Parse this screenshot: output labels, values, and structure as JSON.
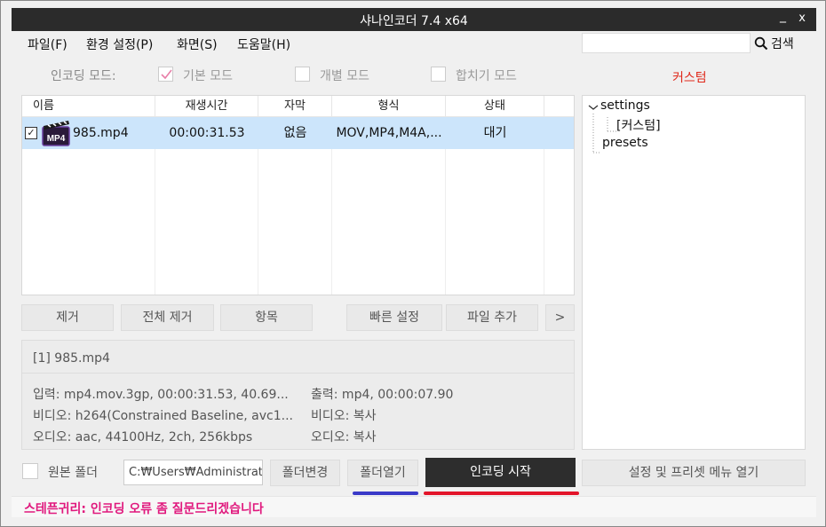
{
  "window": {
    "title": "샤나인코더  7.4 x64",
    "minimize": "_",
    "close": "x"
  },
  "menu": {
    "items": [
      "파일(F)",
      "환경 설정(P)",
      "화면(S)",
      "도움말(H)"
    ],
    "search_label": "검색",
    "search_value": ""
  },
  "mode": {
    "label": "인코딩 모드:",
    "options": [
      {
        "label": "기본 모드",
        "checked": true
      },
      {
        "label": "개별 모드",
        "checked": false
      },
      {
        "label": "합치기 모드",
        "checked": false
      }
    ],
    "custom": "커스텀"
  },
  "filelist": {
    "columns": [
      "이름",
      "재생시간",
      "자막",
      "형식",
      "상태"
    ],
    "rows": [
      {
        "checked": true,
        "icon_text": "MP4",
        "name": "985.mp4",
        "duration": "00:00:31.53",
        "subtitle": "없음",
        "format": "MOV,MP4,M4A,...",
        "status": "대기"
      }
    ]
  },
  "buttons": {
    "remove": "제거",
    "remove_all": "전체 제거",
    "item": "항목",
    "quick_settings": "빠른 설정",
    "add_file": "파일 추가",
    "more": ">"
  },
  "info": {
    "header": "[1] 985.mp4",
    "input": "입력: mp4.mov.3gp, 00:00:31.53, 40.69...",
    "video_in": "비디오: h264(Constrained Baseline, avc1...",
    "audio_in": "오디오: aac, 44100Hz, 2ch, 256kbps",
    "output": "출력: mp4, 00:00:07.90",
    "video_out": "비디오: 복사",
    "audio_out": "오디오: 복사"
  },
  "tree": {
    "root": "settings",
    "child": "[커스텀]",
    "presets": "presets"
  },
  "bottom": {
    "source_folder": "원본 폴더",
    "path": "C:₩Users₩Administrator",
    "change_folder": "폴더변경",
    "open_folder": "폴더열기",
    "start_encoding": "인코딩 시작",
    "open_settings_menu": "설정 및 프리셋 메뉴 열기"
  },
  "status": {
    "text": "스테픈귀리: 인코딩 오류 좀 질문드리겠습니다"
  },
  "colors": {
    "custom": "#e0281a",
    "status": "#e0187d",
    "selected_row": "#cce5fb",
    "accent_blue": "#3a3ac8",
    "accent_red": "#e3152a"
  }
}
